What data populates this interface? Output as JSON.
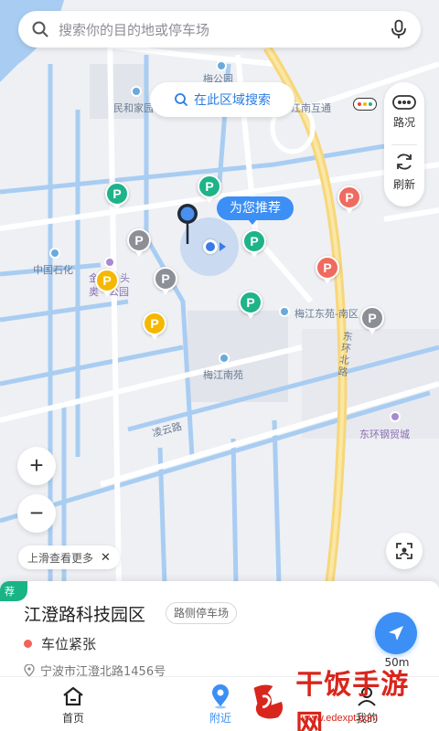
{
  "search": {
    "placeholder": "搜索你的目的地或停车场"
  },
  "map": {
    "area_search_label": "在此区域搜索",
    "recommend_label": "为您推荐",
    "traffic_label": "路况",
    "refresh_label": "刷新",
    "poi": [
      {
        "name": "梅公园"
      },
      {
        "name": "民和家园"
      },
      {
        "name": "江南互通"
      },
      {
        "name": "中国石化"
      },
      {
        "name": "金"
      },
      {
        "name": "头"
      },
      {
        "name": "奥"
      },
      {
        "name": "公园"
      },
      {
        "name": "梅江东苑-南区"
      },
      {
        "name": "梅江南苑"
      },
      {
        "name": "东环钢贸城"
      }
    ],
    "roads": [
      {
        "name": "东环北路"
      },
      {
        "name": "凌云路"
      }
    ],
    "parking_markers": [
      {
        "color": "green",
        "symbol": "P"
      },
      {
        "color": "green",
        "symbol": "P"
      },
      {
        "color": "green",
        "symbol": "P"
      },
      {
        "color": "green",
        "symbol": "P"
      },
      {
        "color": "gray",
        "symbol": "P"
      },
      {
        "color": "gray",
        "symbol": "P"
      },
      {
        "color": "gray",
        "symbol": "P"
      },
      {
        "color": "red",
        "symbol": "P"
      },
      {
        "color": "red",
        "symbol": "P"
      },
      {
        "color": "yellow",
        "symbol": "P"
      },
      {
        "color": "yellow",
        "symbol": "P"
      }
    ],
    "zoom_in": "+",
    "zoom_out": "−",
    "hint_label": "上滑查看更多",
    "hint_close": "✕"
  },
  "card": {
    "tag": "荐",
    "title": "江澄路科技园区",
    "type": "路侧停车场",
    "status": "车位紧张",
    "status_color": "#f0625a",
    "address": "宁波市江澄北路1456号",
    "distance": "50m"
  },
  "tabs": [
    {
      "label": "首页",
      "icon": "home-icon",
      "active": false
    },
    {
      "label": "附近",
      "icon": "location-pin-icon",
      "active": true
    },
    {
      "label": "我的",
      "icon": "user-icon",
      "active": false
    }
  ],
  "watermark": {
    "text": "干饭手游网",
    "sub": "www.edexpt.com"
  },
  "colors": {
    "accent": "#3b8ff5",
    "green": "#1fb38a",
    "red": "#ef6a5f",
    "yellow": "#f5b800",
    "gray": "#8c8f96"
  }
}
